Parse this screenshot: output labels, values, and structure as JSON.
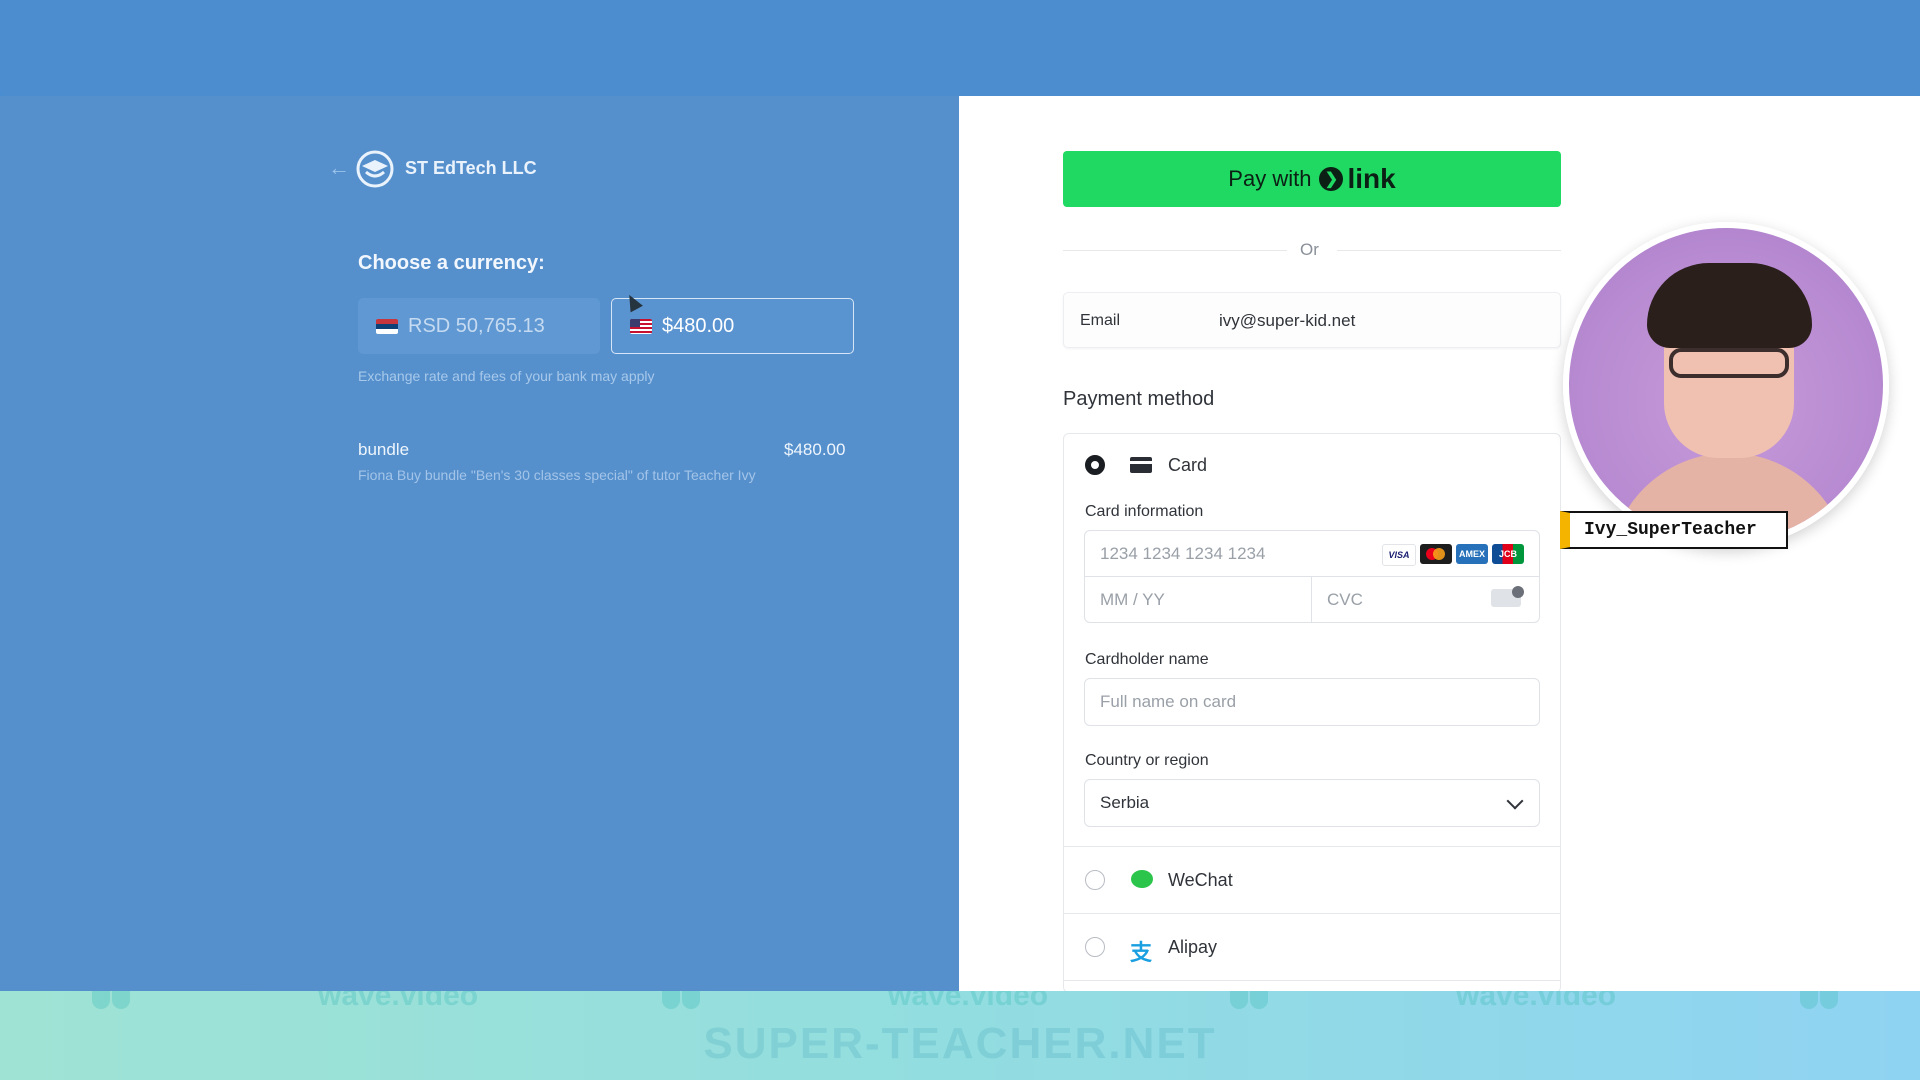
{
  "merchant": {
    "name": "ST EdTech LLC",
    "back_icon": "arrow-left-icon",
    "logo_icon": "merchant-logo-icon"
  },
  "currency": {
    "heading": "Choose a currency:",
    "options": [
      {
        "label": "RSD 50,765.13",
        "flag": "serbia-flag-icon",
        "selected": false
      },
      {
        "label": "$480.00",
        "flag": "us-flag-icon",
        "selected": true
      }
    ],
    "note": "Exchange rate and fees of your bank may apply"
  },
  "line_item": {
    "name": "bundle",
    "price": "$480.00",
    "description": "Fiona Buy bundle \"Ben's 30 classes special\" of tutor Teacher Ivy"
  },
  "payment": {
    "link_button_prefix": "Pay with",
    "link_button_brand": "link",
    "or": "Or",
    "email_label": "Email",
    "email_value": "ivy@super-kid.net",
    "method_title": "Payment method",
    "card": {
      "label": "Card",
      "info_label": "Card information",
      "number_placeholder": "1234 1234 1234 1234",
      "expiry_placeholder": "MM / YY",
      "cvc_placeholder": "CVC",
      "brands": [
        "VISA",
        "",
        "AMEX",
        "JCB"
      ],
      "cardholder_label": "Cardholder name",
      "cardholder_placeholder": "Full name on card",
      "country_label": "Country or region",
      "country_value": "Serbia"
    },
    "wechat_label": "WeChat",
    "alipay_label": "Alipay"
  },
  "overlay": {
    "presenter_tag": "Ivy_SuperTeacher",
    "watermark_text": "wave.video",
    "bottom_watermark": "SUPER-TEACHER.NET"
  },
  "colors": {
    "link_green": "#1fd962",
    "left_panel": "#5590cd",
    "accent_tag": "#f5b400"
  }
}
